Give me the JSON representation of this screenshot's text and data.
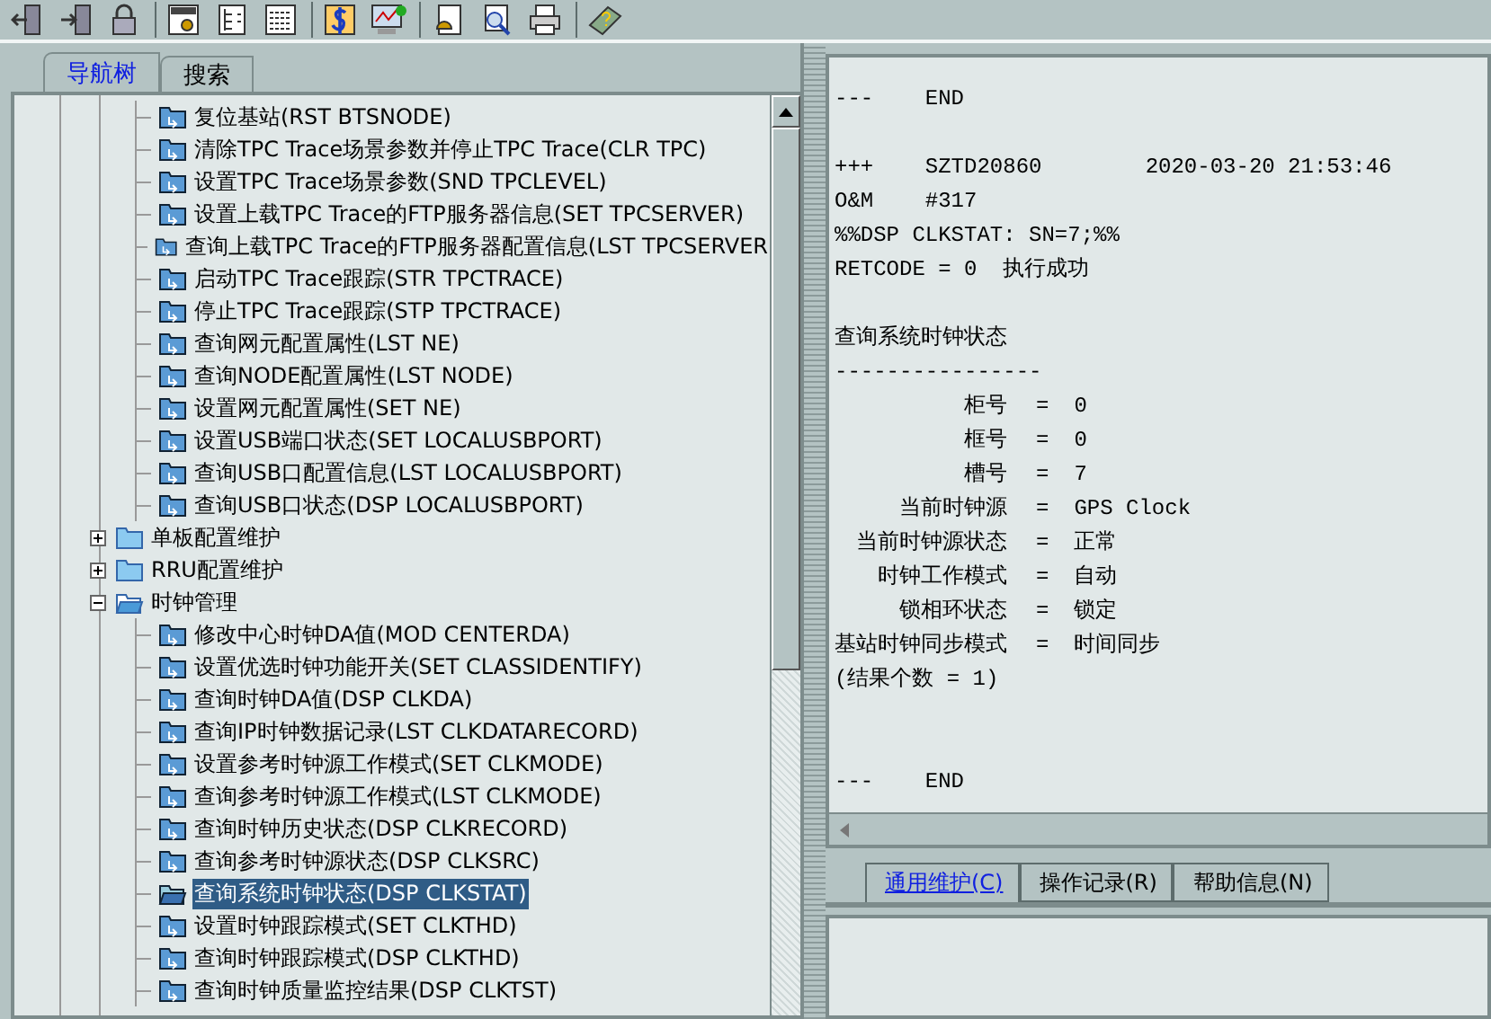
{
  "toolbar": {
    "groups": [
      [
        {
          "kind": "door-left"
        },
        {
          "kind": "door-right"
        },
        {
          "kind": "lock"
        }
      ],
      [
        {
          "kind": "mml-doc"
        },
        {
          "kind": "tree-doc"
        },
        {
          "kind": "grid-doc"
        }
      ],
      [
        {
          "kind": "dollar-doc"
        },
        {
          "kind": "monitor-chart"
        }
      ],
      [
        {
          "kind": "alarm-doc"
        },
        {
          "kind": "search-doc"
        },
        {
          "kind": "printer"
        }
      ],
      [
        {
          "kind": "help-book"
        }
      ]
    ]
  },
  "left_tabs": [
    {
      "label": "导航树",
      "selected": true
    },
    {
      "label": "搜索",
      "selected": false
    }
  ],
  "tree": {
    "partial_children": [
      {
        "label": "复位基站(RST BTSNODE)",
        "selected": false
      },
      {
        "label": "清除TPC Trace场景参数并停止TPC Trace(CLR TPC)",
        "selected": false
      },
      {
        "label": "设置TPC Trace场景参数(SND TPCLEVEL)",
        "selected": false
      },
      {
        "label": "设置上载TPC Trace的FTP服务器信息(SET TPCSERVER)",
        "selected": false
      },
      {
        "label": "查询上载TPC Trace的FTP服务器配置信息(LST TPCSERVER",
        "selected": false
      },
      {
        "label": "启动TPC Trace跟踪(STR TPCTRACE)",
        "selected": false
      },
      {
        "label": "停止TPC Trace跟踪(STP TPCTRACE)",
        "selected": false
      },
      {
        "label": "查询网元配置属性(LST NE)",
        "selected": false
      },
      {
        "label": "查询NODE配置属性(LST NODE)",
        "selected": false
      },
      {
        "label": "设置网元配置属性(SET NE)",
        "selected": false
      },
      {
        "label": "设置USB端口状态(SET LOCALUSBPORT)",
        "selected": false
      },
      {
        "label": "查询USB口配置信息(LST LOCALUSBPORT)",
        "selected": false
      },
      {
        "label": "查询USB口状态(DSP LOCALUSBPORT)",
        "selected": false
      }
    ],
    "groups": [
      {
        "label": "单板配置维护",
        "expanded": false
      },
      {
        "label": "RRU配置维护",
        "expanded": false
      },
      {
        "label": "时钟管理",
        "expanded": true,
        "children": [
          {
            "label": "修改中心时钟DA值(MOD CENTERDA)",
            "selected": false
          },
          {
            "label": "设置优选时钟功能开关(SET CLASSIDENTIFY)",
            "selected": false
          },
          {
            "label": "查询时钟DA值(DSP CLKDA)",
            "selected": false
          },
          {
            "label": "查询IP时钟数据记录(LST CLKDATARECORD)",
            "selected": false
          },
          {
            "label": "设置参考时钟源工作模式(SET CLKMODE)",
            "selected": false
          },
          {
            "label": "查询参考时钟源工作模式(LST CLKMODE)",
            "selected": false
          },
          {
            "label": "查询时钟历史状态(DSP CLKRECORD)",
            "selected": false
          },
          {
            "label": "查询参考时钟源状态(DSP CLKSRC)",
            "selected": false
          },
          {
            "label": "查询系统时钟状态(DSP CLKSTAT)",
            "selected": true
          },
          {
            "label": "设置时钟跟踪模式(SET CLKTHD)",
            "selected": false
          },
          {
            "label": "查询时钟跟踪模式(DSP CLKTHD)",
            "selected": false
          },
          {
            "label": "查询时钟质量监控结果(DSP CLKTST)",
            "selected": false
          }
        ]
      }
    ]
  },
  "output": [
    {
      "kind": "text",
      "text": "---    END"
    },
    {
      "kind": "blank"
    },
    {
      "kind": "text",
      "text": "+++    SZTD20860        2020-03-20 21:53:46"
    },
    {
      "kind": "text",
      "text": "O&M    #317"
    },
    {
      "kind": "text",
      "text": "%%DSP CLKSTAT: SN=7;%%"
    },
    {
      "kind": "text",
      "text": "RETCODE = 0  执行成功"
    },
    {
      "kind": "blank"
    },
    {
      "kind": "text",
      "text": "查询系统时钟状态"
    },
    {
      "kind": "text",
      "text": "----------------"
    },
    {
      "kind": "field",
      "key": "柜号",
      "sign": "=",
      "value": "0"
    },
    {
      "kind": "field",
      "key": "框号",
      "sign": "=",
      "value": "0"
    },
    {
      "kind": "field",
      "key": "槽号",
      "sign": "=",
      "value": "7"
    },
    {
      "kind": "field",
      "key": "当前时钟源",
      "sign": "=",
      "value": "GPS Clock"
    },
    {
      "kind": "field",
      "key": "当前时钟源状态",
      "sign": "=",
      "value": "正常"
    },
    {
      "kind": "field",
      "key": "时钟工作模式",
      "sign": "=",
      "value": "自动"
    },
    {
      "kind": "field",
      "key": "锁相环状态",
      "sign": "=",
      "value": "锁定"
    },
    {
      "kind": "field",
      "key": "基站时钟同步模式",
      "sign": "=",
      "value": "时间同步"
    },
    {
      "kind": "text",
      "text": "(结果个数 = 1)"
    },
    {
      "kind": "blank"
    },
    {
      "kind": "blank"
    },
    {
      "kind": "text",
      "text": "---    END"
    }
  ],
  "bottom_tabs": [
    {
      "label": "通用维护(C)",
      "selected": true
    },
    {
      "label": "操作记录(R)",
      "selected": false
    },
    {
      "label": "帮助信息(N)",
      "selected": false
    }
  ]
}
